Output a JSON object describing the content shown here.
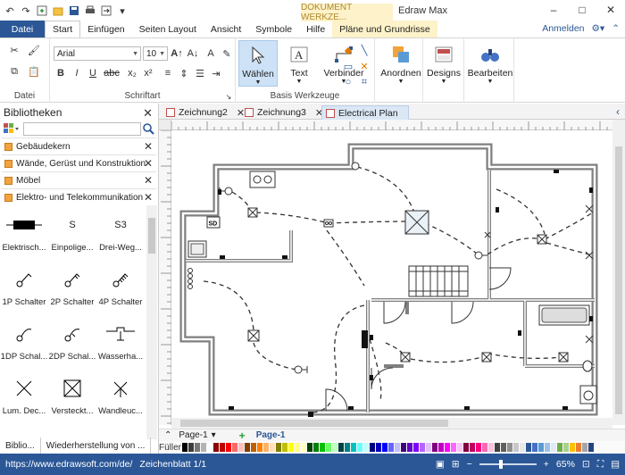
{
  "app": {
    "title": "Edraw Max",
    "contextual_header": "DOKUMENT WERKZE..."
  },
  "quick_access": [
    "undo-icon",
    "redo-icon",
    "new-icon",
    "open-icon",
    "save-icon",
    "print-icon",
    "export-icon",
    "dropdown-icon"
  ],
  "window_controls": [
    "minimize-icon",
    "maximize-icon",
    "close-icon"
  ],
  "ribbon": {
    "file_tab": "Datei",
    "tabs": [
      "Start",
      "Einfügen",
      "Seiten Layout",
      "Ansicht",
      "Symbole",
      "Hilfe"
    ],
    "context_tab": "Pläne und Grundrisse",
    "active_tab": "Start",
    "signin": "Anmelden",
    "groups": {
      "datei": "Datei",
      "schriftart": "Schriftart",
      "basis": "Basis Werkzeuge"
    },
    "font_name": "Arial",
    "font_size": "10",
    "format_buttons": [
      "B",
      "I",
      "U",
      "abc",
      "x₂",
      "x²"
    ],
    "big_buttons": {
      "waehlen": "Wählen",
      "text": "Text",
      "verbinder": "Verbinder",
      "anordnen": "Anordnen",
      "designs": "Designs",
      "bearbeiten": "Bearbeiten"
    }
  },
  "library": {
    "title": "Bibliotheken",
    "categories": [
      "Gebäudekern",
      "Wände, Gerüst und Konstruktion",
      "Möbel",
      "Elektro- und Telekommunikation"
    ],
    "shapes": [
      {
        "label": "Elektrisch...",
        "glyph": "bar"
      },
      {
        "label": "Einpolige...",
        "glyph": "S"
      },
      {
        "label": "Drei-Weg...",
        "glyph": "S3"
      },
      {
        "label": "1P Schalter",
        "glyph": "sw1"
      },
      {
        "label": "2P Schalter",
        "glyph": "sw2"
      },
      {
        "label": "4P Schalter",
        "glyph": "sw4"
      },
      {
        "label": "1DP Schal...",
        "glyph": "dp1"
      },
      {
        "label": "2DP Schal...",
        "glyph": "dp2"
      },
      {
        "label": "Wasserha...",
        "glyph": "tap"
      },
      {
        "label": "Lum. Dec...",
        "glyph": "x"
      },
      {
        "label": "Versteckt...",
        "glyph": "boxx"
      },
      {
        "label": "Wandleuc...",
        "glyph": "wl"
      }
    ],
    "bottom_tabs": [
      "Biblio...",
      "Wiederherstellung von ..."
    ]
  },
  "doc_tabs": [
    {
      "label": "Zeichnung2",
      "active": false
    },
    {
      "label": "Zeichnung3",
      "active": false
    },
    {
      "label": "Electrical Plan",
      "active": true
    }
  ],
  "drawing": {
    "sd_label": "SD"
  },
  "pages": {
    "page_tab": "Page-1",
    "current": "Page-1"
  },
  "palette_label": "Füller",
  "palette": [
    "#000000",
    "#3c3c3c",
    "#787878",
    "#b4b4b4",
    "#ffffff",
    "#8b0000",
    "#c00000",
    "#ff0000",
    "#ff6666",
    "#ffc0c0",
    "#7f3f00",
    "#c06000",
    "#ff8000",
    "#ffb366",
    "#ffe0c0",
    "#7f7f00",
    "#bfbf00",
    "#ffff00",
    "#ffff80",
    "#ffffc0",
    "#003f00",
    "#008000",
    "#00c000",
    "#66ff66",
    "#c0ffc0",
    "#004040",
    "#008080",
    "#00c0c0",
    "#66ffff",
    "#c0ffff",
    "#00007f",
    "#0000c0",
    "#0000ff",
    "#6666ff",
    "#c0c0ff",
    "#3f007f",
    "#6000c0",
    "#8000ff",
    "#b366ff",
    "#e0c0ff",
    "#7f007f",
    "#c000c0",
    "#ff00ff",
    "#ff66ff",
    "#ffc0ff",
    "#7f0040",
    "#c00060",
    "#ff0080",
    "#ff66b3",
    "#ffc0e0",
    "#404040",
    "#606060",
    "#909090",
    "#c8c8c8",
    "#e8e8e8",
    "#2b5797",
    "#4472c4",
    "#5b9bd5",
    "#9dc3e6",
    "#deebf7",
    "#70ad47",
    "#a9d18e",
    "#ffc000",
    "#ed7d31",
    "#a5a5a5",
    "#264478"
  ],
  "status": {
    "url": "https://www.edrawsoft.com/de/",
    "sheet": "Zeichenblatt 1/1",
    "zoom": "65%"
  }
}
